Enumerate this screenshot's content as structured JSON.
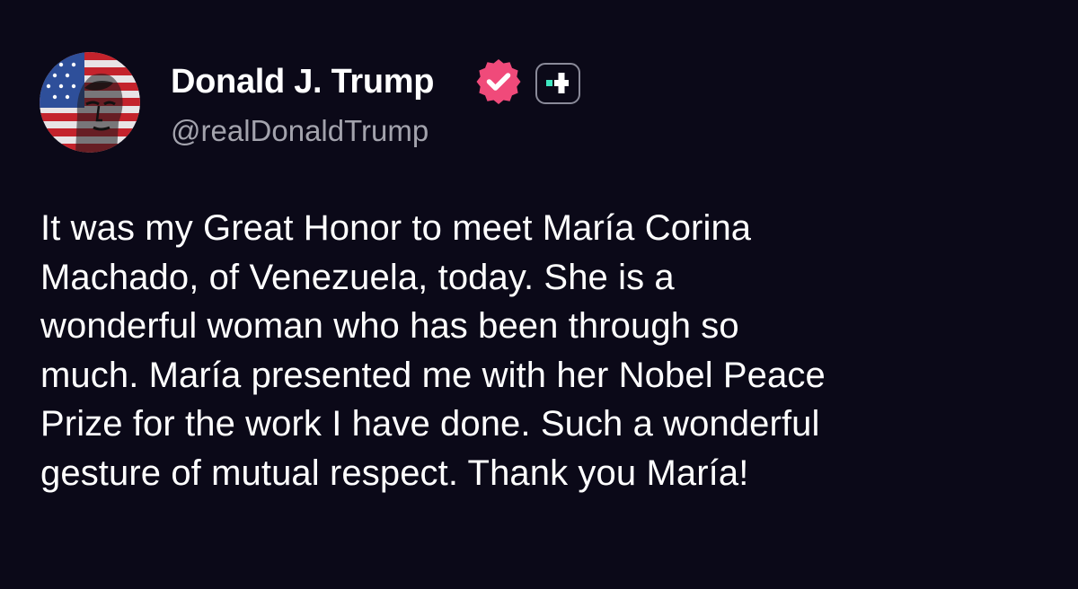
{
  "author": {
    "display_name": "Donald J. Trump",
    "handle": "@realDonaldTrump",
    "avatar_icon": "american-flag-portrait-icon",
    "verified_icon": "verified-check-badge-icon",
    "verified_color": "#f04a7a",
    "plus_icon": "plus-badge-icon",
    "plus_color": "#3ee6c0"
  },
  "post": {
    "lines": [
      "It was my Great Honor to meet María Corina",
      "Machado, of Venezuela, today. She is a",
      "wonderful woman who has been through so",
      "much. María presented me with her Nobel Peace",
      "Prize for the work I have done. Such a wonderful",
      "gesture of mutual respect. Thank you María!"
    ]
  },
  "colors": {
    "background": "#0b0918",
    "text": "#ffffff",
    "secondary_text": "#a3a3ad"
  }
}
